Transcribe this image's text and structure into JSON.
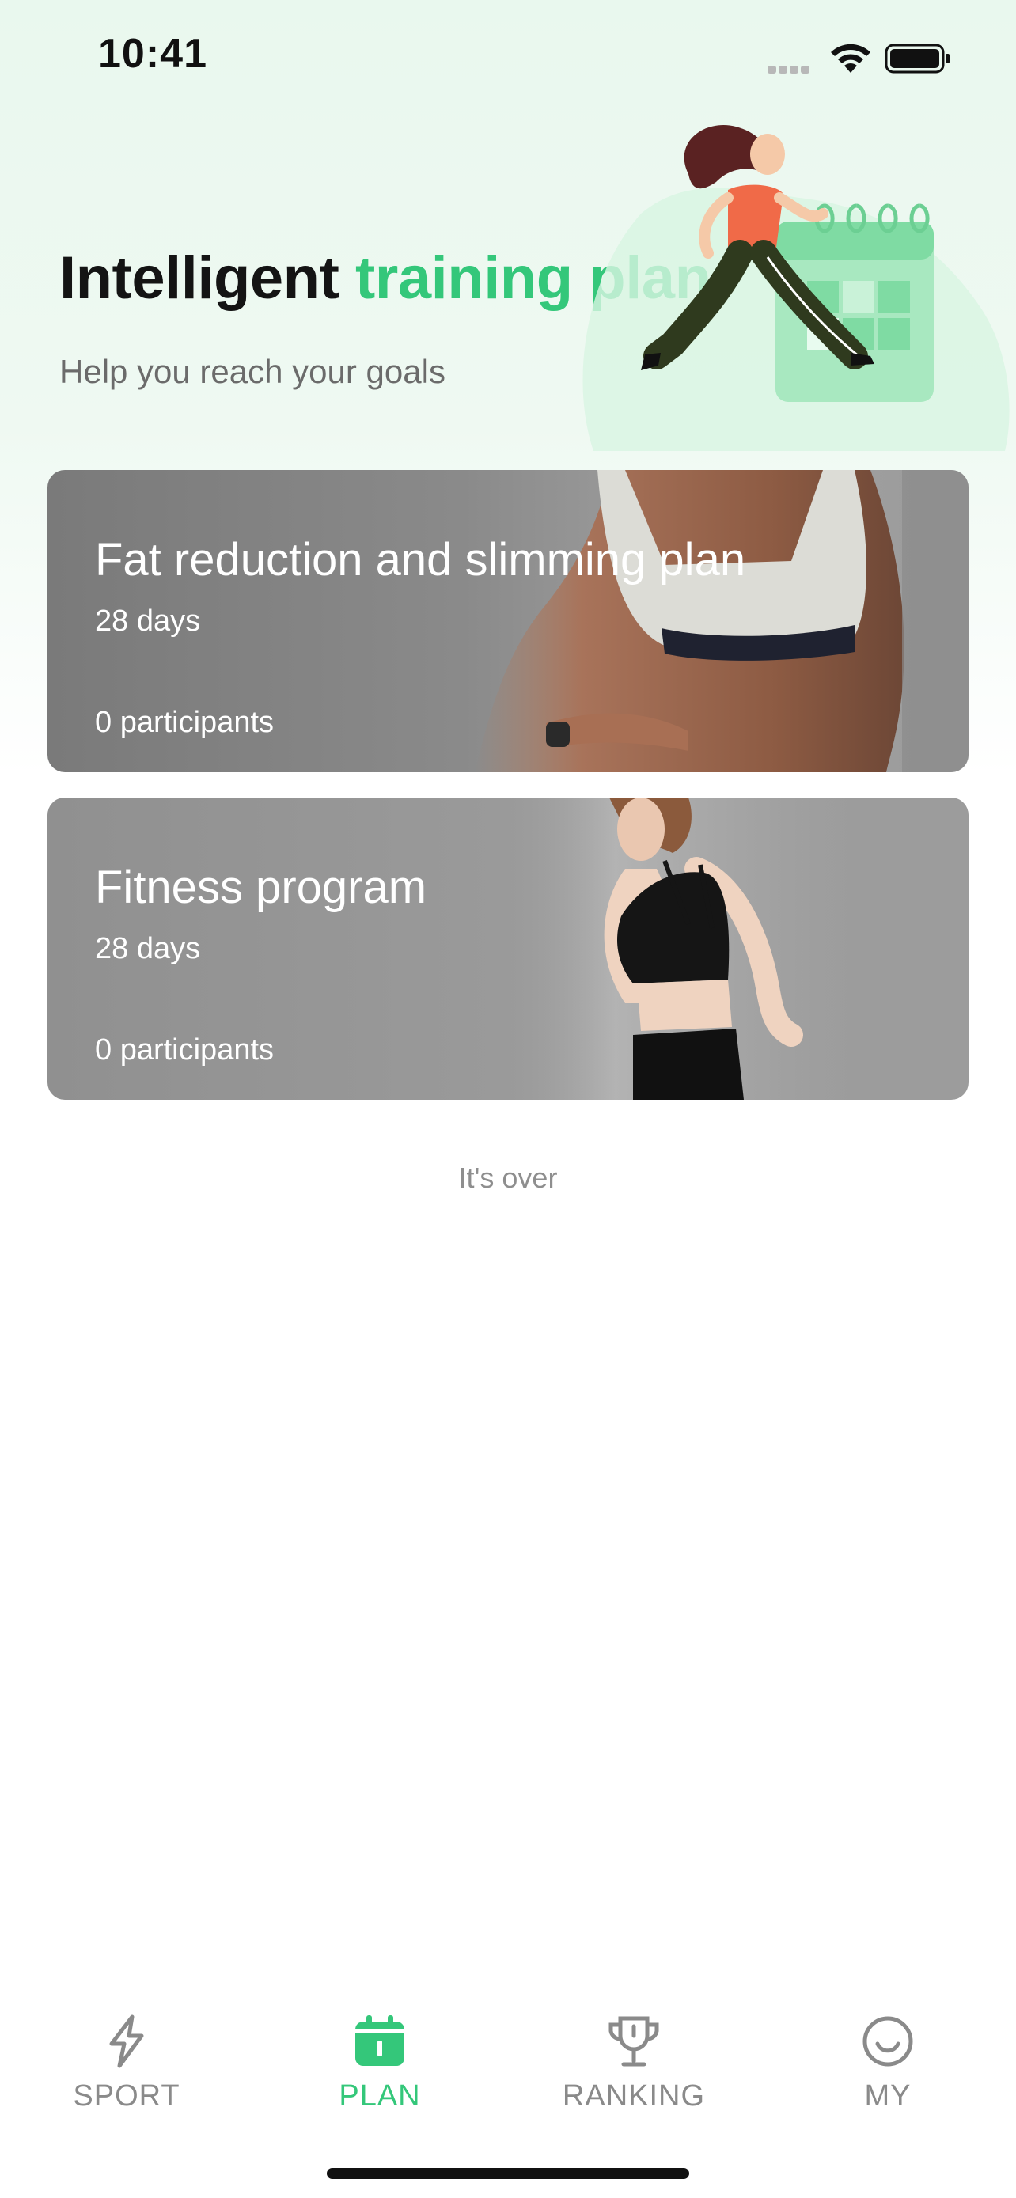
{
  "status_bar": {
    "time": "10:41"
  },
  "hero": {
    "title_plain": "Intelligent ",
    "title_accent": "training plan",
    "subtitle": "Help you reach your goals",
    "accent_color": "#34c77a"
  },
  "plans": [
    {
      "title": "Fat reduction and slimming plan",
      "duration": "28 days",
      "participants": "0 participants"
    },
    {
      "title": "Fitness program",
      "duration": "28 days",
      "participants": "0 participants"
    }
  ],
  "list_end_text": "It's over",
  "tab_bar": {
    "tabs": [
      {
        "label": "SPORT",
        "icon": "lightning-icon",
        "active": false
      },
      {
        "label": "PLAN",
        "icon": "calendar-icon",
        "active": true
      },
      {
        "label": "RANKING",
        "icon": "trophy-icon",
        "active": false
      },
      {
        "label": "MY",
        "icon": "smiley-icon",
        "active": false
      }
    ],
    "active_color": "#34c77a",
    "inactive_color": "#8a8a8a"
  }
}
